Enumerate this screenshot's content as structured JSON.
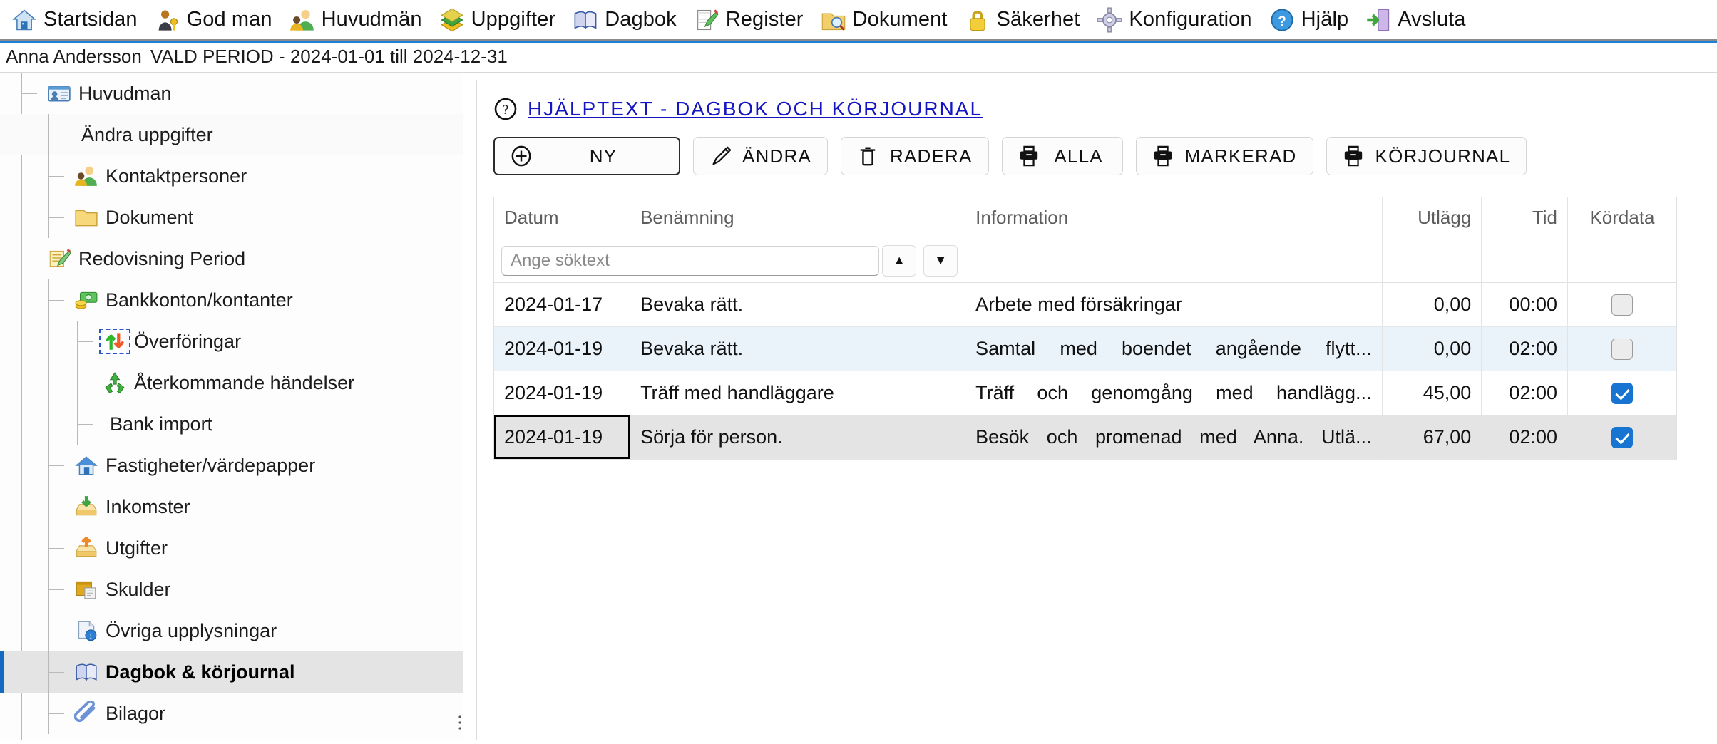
{
  "menubar": {
    "items": [
      {
        "label": "Startsidan",
        "icon": "home-icon"
      },
      {
        "label": "God man",
        "icon": "person-key-icon"
      },
      {
        "label": "Huvudmän",
        "icon": "people-icon"
      },
      {
        "label": "Uppgifter",
        "icon": "books-icon"
      },
      {
        "label": "Dagbok",
        "icon": "book-icon"
      },
      {
        "label": "Register",
        "icon": "notepad-pencil-icon"
      },
      {
        "label": "Dokument",
        "icon": "folder-search-icon"
      },
      {
        "label": "Säkerhet",
        "icon": "lock-icon"
      },
      {
        "label": "Konfiguration",
        "icon": "gear-icon"
      },
      {
        "label": "Hjälp",
        "icon": "question-circle-icon"
      },
      {
        "label": "Avsluta",
        "icon": "exit-door-icon"
      }
    ]
  },
  "periodbar": {
    "client_name": "Anna Andersson",
    "period_text": "VALD PERIOD - 2024-01-01 till 2024-12-31"
  },
  "sidebar": {
    "items": [
      {
        "label": "Huvudman",
        "icon": "id-card-icon",
        "level": 1,
        "selected": false
      },
      {
        "label": "Ändra uppgifter",
        "icon": "none",
        "level": 2,
        "selected": false
      },
      {
        "label": "Kontaktpersoner",
        "icon": "people-icon",
        "level": 2,
        "selected": false
      },
      {
        "label": "Dokument",
        "icon": "folder-icon",
        "level": 2,
        "selected": false
      },
      {
        "label": "Redovisning Period",
        "icon": "note-pencil-icon",
        "level": 1,
        "selected": false
      },
      {
        "label": "Bankkonton/kontanter",
        "icon": "money-icon",
        "level": 2,
        "selected": false
      },
      {
        "label": "Överföringar",
        "icon": "transfer-icon",
        "level": 3,
        "selected": false,
        "focus": true
      },
      {
        "label": "Återkommande händelser",
        "icon": "recycle-icon",
        "level": 3,
        "selected": false
      },
      {
        "label": "Bank import",
        "icon": "none",
        "level": 3,
        "selected": false
      },
      {
        "label": "Fastigheter/värdepapper",
        "icon": "house-icon",
        "level": 2,
        "selected": false
      },
      {
        "label": "Inkomster",
        "icon": "inbox-down-icon",
        "level": 2,
        "selected": false
      },
      {
        "label": "Utgifter",
        "icon": "inbox-up-icon",
        "level": 2,
        "selected": false
      },
      {
        "label": "Skulder",
        "icon": "debt-icon",
        "level": 2,
        "selected": false
      },
      {
        "label": "Övriga upplysningar",
        "icon": "info-doc-icon",
        "level": 2,
        "selected": false
      },
      {
        "label": "Dagbok & körjournal",
        "icon": "book-icon",
        "level": 2,
        "selected": true
      },
      {
        "label": "Bilagor",
        "icon": "paperclip-icon",
        "level": 2,
        "selected": false
      }
    ]
  },
  "main": {
    "help_link": "HJÄLPTEXT - DAGBOK OCH KÖRJOURNAL",
    "toolbar": [
      {
        "label": "NY",
        "icon": "plus-circle-icon",
        "primary": true
      },
      {
        "label": "ÄNDRA",
        "icon": "pencil-icon",
        "primary": false
      },
      {
        "label": "RADERA",
        "icon": "trash-icon",
        "primary": false
      },
      {
        "label": "ALLA",
        "icon": "printer-icon",
        "primary": false
      },
      {
        "label": "MARKERAD",
        "icon": "printer-icon",
        "primary": false
      },
      {
        "label": "KÖRJOURNAL",
        "icon": "printer-icon",
        "primary": false
      }
    ],
    "search": {
      "placeholder": "Ange söktext",
      "value": "",
      "sort_up": "▲",
      "sort_down": "▼"
    },
    "table": {
      "columns": [
        "Datum",
        "Benämning",
        "Information",
        "Utlägg",
        "Tid",
        "Kördata"
      ],
      "rows": [
        {
          "datum": "2024-01-17",
          "benamning": "Bevaka rätt.",
          "information": "Arbete med försäkringar",
          "utlagg": "0,00",
          "tid": "00:00",
          "kordata": false,
          "selected": false
        },
        {
          "datum": "2024-01-19",
          "benamning": "Bevaka rätt.",
          "information": "Samtal med boendet angående flytt...",
          "utlagg": "0,00",
          "tid": "02:00",
          "kordata": false,
          "selected": false
        },
        {
          "datum": "2024-01-19",
          "benamning": "Träff med handläggare",
          "information": "Träff och genomgång med handlägg...",
          "utlagg": "45,00",
          "tid": "02:00",
          "kordata": true,
          "selected": false
        },
        {
          "datum": "2024-01-19",
          "benamning": "Sörja för person.",
          "information": "Besök och promenad med Anna. Utlä...",
          "utlagg": "67,00",
          "tid": "02:00",
          "kordata": true,
          "selected": true
        }
      ]
    }
  },
  "colors": {
    "accent_blue": "#1e7fd4",
    "link_blue": "#1515c4",
    "row_even": "#eaf2fa",
    "row_selected": "#e4e4e4",
    "checkbox_on": "#1775d1"
  }
}
